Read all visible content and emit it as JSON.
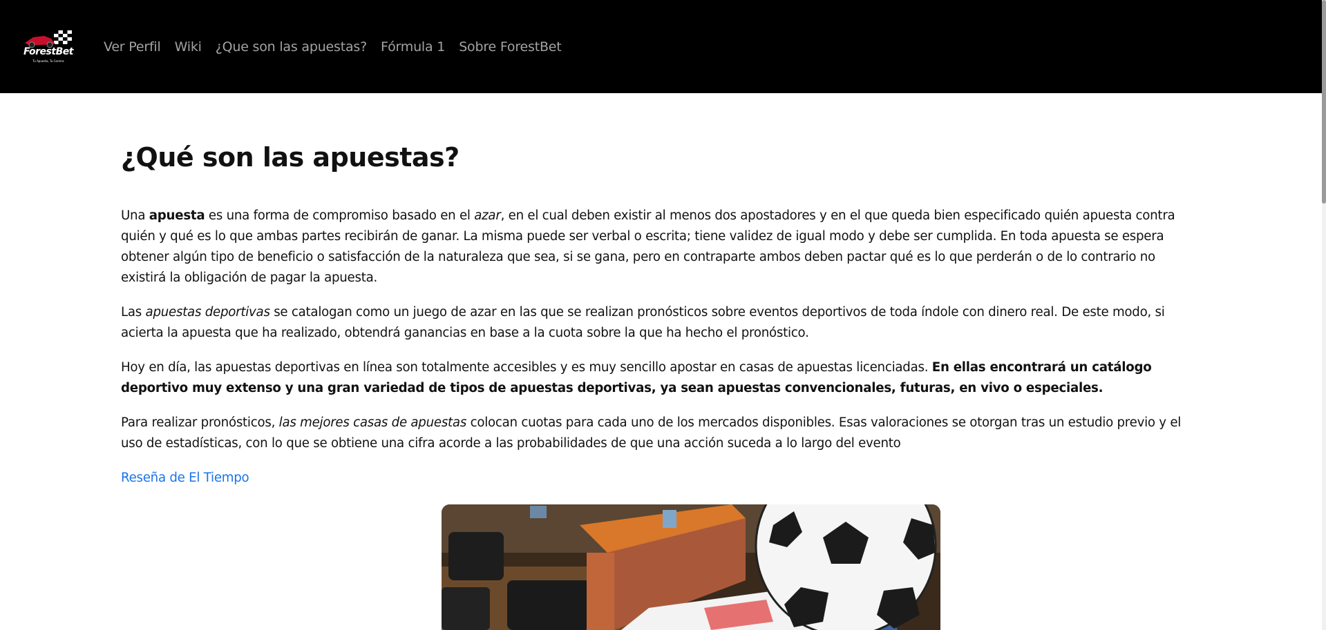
{
  "brand": {
    "name": "ForestBet",
    "tagline": "Tu Apuesta, Tu Carrera"
  },
  "nav": {
    "items": [
      {
        "label": "Ver Perfil"
      },
      {
        "label": "Wiki"
      },
      {
        "label": "¿Que son las apuestas?"
      },
      {
        "label": "Fórmula 1"
      },
      {
        "label": "Sobre ForestBet"
      }
    ]
  },
  "main": {
    "title": "¿Qué son las apuestas?",
    "p1": {
      "t1": "Una ",
      "b1": "apuesta",
      "t2": " es una forma de compromiso basado en el ",
      "i1": "azar",
      "t3": ", en el cual deben existir al menos dos apostadores y en el que queda bien especificado quién apuesta contra quién y qué es lo que ambas partes recibirán de ganar. La misma puede ser verbal o escrita; tiene validez de igual modo y debe ser cumplida. En toda apuesta se espera obtener algún tipo de beneficio o satisfacción de la naturaleza que sea, si se gana, pero en contraparte ambos deben pactar qué es lo que perderán o de lo contrario no existirá la obligación de pagar la apuesta."
    },
    "p2": {
      "t1": "Las ",
      "i1": "apuestas deportivas",
      "t2": " se catalogan como un juego de azar en las que se realizan pronósticos sobre eventos deportivos de toda índole con dinero real. De este modo, si acierta la apuesta que ha realizado, obtendrá ganancias en base a la cuota sobre la que ha hecho el pronóstico."
    },
    "p3": {
      "t1": "Hoy en día, las apuestas deportivas en línea son totalmente accesibles y es muy sencillo apostar en casas de apuestas licenciadas. ",
      "b1": "En ellas encontrará un catálogo deportivo muy extenso y una gran variedad de tipos de apuestas deportivas, ya sean apuestas convencionales, futuras, en vivo o especiales."
    },
    "p4": {
      "t1": "Para realizar pronósticos, ",
      "i1": "las mejores casas de apuestas",
      "t2": " colocan cuotas para cada uno de los mercados disponibles. Esas valoraciones se otorgan tras un estudio previo y el uso de estadísticas, con lo que se obtiene una cifra acorde a las probabilidades de que una acción suceda a lo largo del evento"
    },
    "review_link": "Reseña de El Tiempo"
  },
  "colors": {
    "navbar_bg": "#000000",
    "nav_text": "#a3a3a3",
    "link": "#1a73e8",
    "body_text": "#111111"
  }
}
